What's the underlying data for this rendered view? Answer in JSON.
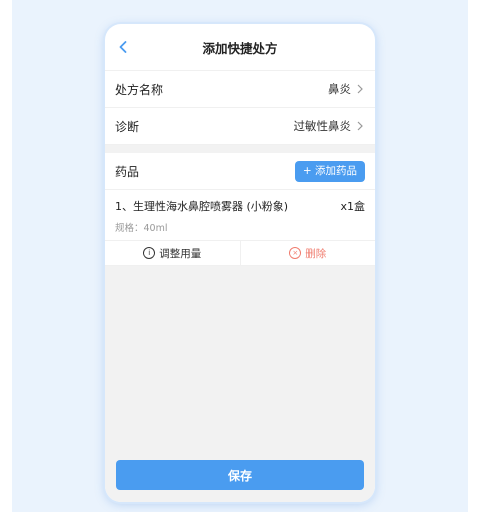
{
  "header": {
    "title": "添加快捷处方",
    "back_icon": "chevron-left-icon"
  },
  "form": {
    "rows": [
      {
        "label": "处方名称",
        "value": "鼻炎"
      },
      {
        "label": "诊断",
        "value": "过敏性鼻炎"
      }
    ]
  },
  "medicines": {
    "title": "药品",
    "add_button": "+ 添加药品",
    "items": [
      {
        "name": "1、生理性海水鼻腔喷雾器 (小粉象)",
        "quantity": "x1盒",
        "spec": "规格：40ml"
      }
    ],
    "actions": {
      "adjust": "调整用量",
      "delete": "删除"
    }
  },
  "footer": {
    "save_label": "保存"
  },
  "colors": {
    "accent": "#4a9cf0",
    "danger": "#f07c6e",
    "background": "#aacdf6"
  }
}
